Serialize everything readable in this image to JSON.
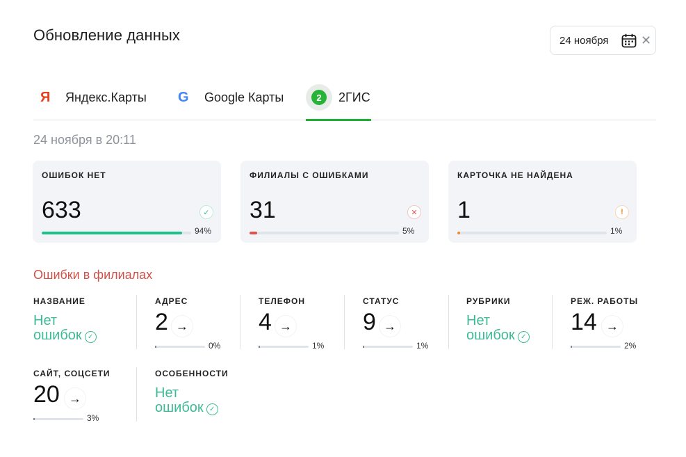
{
  "header": {
    "title": "Обновление данных",
    "date_value": "24 ноября",
    "calendar_icon": "calendar-icon",
    "clear_icon": "close-icon"
  },
  "tabs": [
    {
      "logo": "Я",
      "label": "Яндекс.Карты",
      "active": false
    },
    {
      "logo": "G",
      "label": "Google Карты",
      "active": false
    },
    {
      "logo": "2",
      "label": "2ГИС",
      "active": true
    }
  ],
  "updated_at": "24 ноября в 20:11",
  "summary": [
    {
      "label": "ОШИБОК НЕТ",
      "value": "633",
      "percent": "94%",
      "fraction": 0.94,
      "status": "ok",
      "icon": "✓",
      "color": "#20c08a"
    },
    {
      "label": "ФИЛИАЛЫ С ОШИБКАМИ",
      "value": "31",
      "percent": "5%",
      "fraction": 0.05,
      "status": "error",
      "icon": "✕",
      "color": "#e0524a"
    },
    {
      "label": "КАРТОЧКА НЕ НАЙДЕНА",
      "value": "1",
      "percent": "1%",
      "fraction": 0.01,
      "status": "warning",
      "icon": "!",
      "color": "#ef8a2a"
    }
  ],
  "errors_section": {
    "title": "Ошибки в филиалах",
    "no_errors_text_line1": "Нет",
    "no_errors_text_line2": "ошибок",
    "categories": [
      {
        "label": "НАЗВАНИЕ",
        "no_errors": true
      },
      {
        "label": "АДРЕС",
        "value": "2",
        "percent": "0%"
      },
      {
        "label": "ТЕЛЕФОН",
        "value": "4",
        "percent": "1%"
      },
      {
        "label": "СТАТУС",
        "value": "9",
        "percent": "1%"
      },
      {
        "label": "РУБРИКИ",
        "no_errors": true
      },
      {
        "label": "РЕЖ. РАБОТЫ",
        "value": "14",
        "percent": "2%"
      },
      {
        "label": "САЙТ, СОЦСЕТИ",
        "value": "20",
        "percent": "3%"
      },
      {
        "label": "ОСОБЕННОСТИ",
        "no_errors": true
      }
    ]
  },
  "colors": {
    "accent_green": "#1db235",
    "ok": "#3dbb95",
    "error": "#d2504a",
    "warning": "#ef8a2a"
  }
}
